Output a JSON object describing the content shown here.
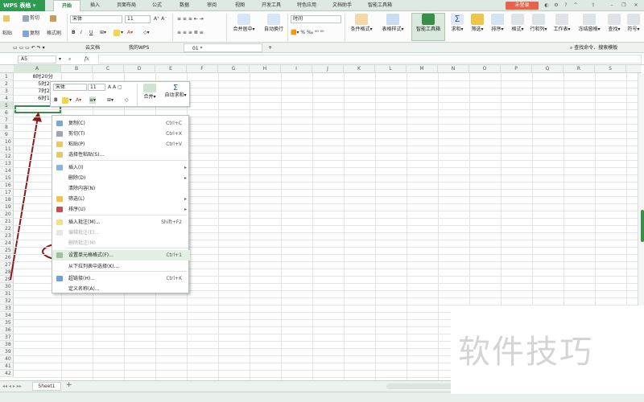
{
  "app": {
    "logo": "WPS 表格"
  },
  "menu_tabs": [
    {
      "label": "开始"
    },
    {
      "label": "插入"
    },
    {
      "label": "页面布局"
    },
    {
      "label": "公式"
    },
    {
      "label": "数据"
    },
    {
      "label": "审阅"
    },
    {
      "label": "视图"
    },
    {
      "label": "开发工具"
    },
    {
      "label": "特色应用"
    },
    {
      "label": "文档助手"
    },
    {
      "label": "智能工具箱"
    }
  ],
  "login_label": "未登录",
  "ribbon": {
    "cut": "剪切",
    "paste": "粘贴",
    "copy": "复制",
    "format_painter": "格式刷",
    "font_name": "宋体",
    "font_size": "11",
    "bold": "B",
    "italic": "I",
    "underline": "U",
    "merge_center": "合并居中",
    "wrap_text": "自动换行",
    "number_format": "时间",
    "cond_format": "条件格式",
    "table_style": "表格样式",
    "smart_toolbox": "智能工具箱",
    "sum": "求和",
    "filter": "筛选",
    "sort": "排序",
    "format": "格式",
    "rowcol": "行和列",
    "worksheet": "工作表",
    "freeze": "冻结窗格",
    "find": "查找",
    "symbol": "符号"
  },
  "doc_tabs": [
    {
      "label": "云文档"
    },
    {
      "label": "我的WPS"
    },
    {
      "label": "01 *"
    }
  ],
  "search_label": "查找命令、搜索模板",
  "formula_bar": {
    "cell_ref": "A5",
    "fx": "fx"
  },
  "columns": [
    "A",
    "B",
    "C",
    "D",
    "E",
    "F",
    "G",
    "H",
    "I",
    "J",
    "K",
    "L",
    "M",
    "N",
    "O",
    "P",
    "Q",
    "R",
    "S"
  ],
  "rows": [
    "1",
    "2",
    "3",
    "4",
    "5",
    "6",
    "7",
    "8",
    "9",
    "10",
    "11",
    "12",
    "13",
    "14",
    "15",
    "16",
    "17",
    "18",
    "19",
    "20",
    "21",
    "22",
    "23",
    "24",
    "25",
    "26",
    "27",
    "28",
    "29",
    "30",
    "31",
    "32",
    "33",
    "34",
    "35",
    "36",
    "37",
    "38",
    "39",
    "40",
    "41",
    "42"
  ],
  "cells": [
    {
      "ref": "A1",
      "value": "8时20分"
    },
    {
      "ref": "A2",
      "value": "5时20"
    },
    {
      "ref": "A3",
      "value": "7时20"
    },
    {
      "ref": "A4",
      "value": "6时15"
    }
  ],
  "mini_toolbar": {
    "font": "宋体",
    "size": "11",
    "merge": "合并",
    "autosum": "自动求和"
  },
  "context_menu": [
    {
      "label": "复制(C)",
      "shortcut": "Ctrl+C",
      "icon": "copy-icon"
    },
    {
      "label": "剪切(T)",
      "shortcut": "Ctrl+X",
      "icon": "cut-icon"
    },
    {
      "label": "粘贴(P)",
      "shortcut": "Ctrl+V",
      "icon": "paste-icon"
    },
    {
      "label": "选择性粘贴(S)...",
      "shortcut": "",
      "icon": "paste-special-icon"
    },
    {
      "label": "插入(I)",
      "shortcut": "",
      "icon": "insert-icon",
      "submenu": true
    },
    {
      "label": "删除(D)",
      "shortcut": "",
      "icon": "",
      "submenu": true
    },
    {
      "label": "清除内容(N)",
      "shortcut": "",
      "icon": ""
    },
    {
      "label": "筛选(L)",
      "shortcut": "",
      "icon": "filter-icon",
      "submenu": true
    },
    {
      "label": "排序(U)",
      "shortcut": "",
      "icon": "sort-icon",
      "submenu": true
    },
    {
      "label": "插入批注(M)...",
      "shortcut": "Shift+F2",
      "icon": "comment-icon"
    },
    {
      "label": "编辑批注(E)...",
      "shortcut": "",
      "icon": "edit-comment-icon",
      "disabled": true
    },
    {
      "label": "删除批注(M)",
      "shortcut": "",
      "icon": "",
      "disabled": true
    },
    {
      "label": "设置单元格格式(F)...",
      "shortcut": "Ctrl+1",
      "icon": "format-cells-icon",
      "highlight": true
    },
    {
      "label": "从下拉列表中选择(K)...",
      "shortcut": "",
      "icon": ""
    },
    {
      "label": "超链接(H)...",
      "shortcut": "Ctrl+K",
      "icon": "hyperlink-icon"
    },
    {
      "label": "定义名称(A)...",
      "shortcut": "",
      "icon": ""
    }
  ],
  "sheet_tab": "Sheet1",
  "watermark": "软件技巧",
  "colors": {
    "accent": "#2f9a52",
    "annotation": "#8b1a1a",
    "login": "#e7624a"
  }
}
